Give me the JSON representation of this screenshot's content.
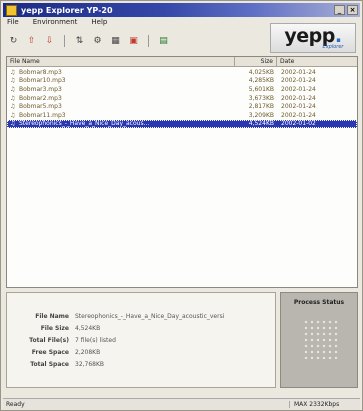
{
  "window": {
    "title": "yepp Explorer YP-20",
    "minimize_label": "_",
    "close_label": "×"
  },
  "menu": {
    "items": [
      "File",
      "Environment",
      "Help"
    ]
  },
  "toolbar": {
    "icons": [
      "refresh-icon",
      "upload-icon",
      "download-icon",
      "sort-icon",
      "settings-icon",
      "grid-icon",
      "delete-icon",
      "exit-icon"
    ]
  },
  "logo": {
    "brand": "yepp",
    "dot": ".",
    "sub": "Explorer"
  },
  "file_list": {
    "columns": {
      "name": "File Name",
      "size": "Size",
      "date": "Date"
    },
    "rows": [
      {
        "name": "Bobmar8.mp3",
        "size": "4,025KB",
        "date": "2002-01-24"
      },
      {
        "name": "Bobmar10.mp3",
        "size": "4,285KB",
        "date": "2002-01-24"
      },
      {
        "name": "Bobmar3.mp3",
        "size": "5,601KB",
        "date": "2002-01-24"
      },
      {
        "name": "Bobmar2.mp3",
        "size": "3,673KB",
        "date": "2002-01-24"
      },
      {
        "name": "Bobmar5.mp3",
        "size": "2,817KB",
        "date": "2002-01-24"
      },
      {
        "name": "Bobmar11.mp3",
        "size": "3,209KB",
        "date": "2002-01-24"
      },
      {
        "name": "Stereophonics_-_Have_a_Nice_Day_acous...",
        "size": "4,524KB",
        "date": "2002-01-02",
        "selected": true
      }
    ]
  },
  "info": {
    "file_name_label": "File Name",
    "file_name_value": "Stereophonics_-_Have_a_Nice_Day_acoustic_versi",
    "file_size_label": "File Size",
    "file_size_value": "4,524KB",
    "total_files_label": "Total File(s)",
    "total_files_value": "7 file(s) listed",
    "free_space_label": "Free Space",
    "free_space_value": "2,208KB",
    "total_space_label": "Total Space",
    "total_space_value": "32,768KB"
  },
  "process": {
    "title": "Process Status"
  },
  "statusbar": {
    "left": "Ready",
    "right": "MAX 2332Kbps"
  },
  "colors": {
    "titlebar": "#1b2a84",
    "selection": "#2b39b0",
    "logo_accent": "#2d70c8"
  }
}
